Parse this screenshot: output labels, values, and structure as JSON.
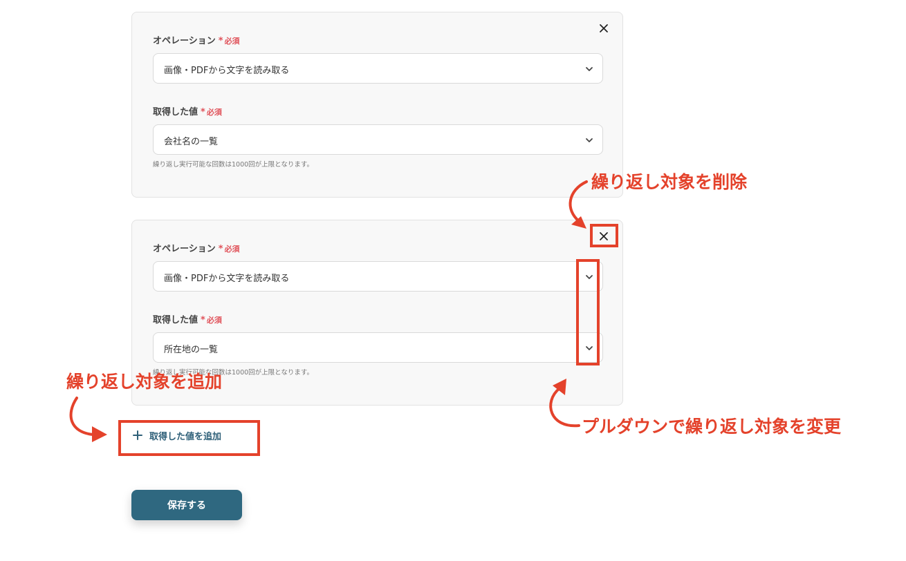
{
  "blocks": [
    {
      "operation_label": "オペレーション",
      "required_star": "*",
      "required_text": "必須",
      "operation_value": "画像・PDFから文字を読み取る",
      "value_label": "取得した値",
      "value_value": "会社名の一覧",
      "helper_text": "繰り返し実行可能な回数は1000回が上限となります。"
    },
    {
      "operation_label": "オペレーション",
      "required_star": "*",
      "required_text": "必須",
      "operation_value": "画像・PDFから文字を読み取る",
      "value_label": "取得した値",
      "value_value": "所在地の一覧",
      "helper_text": "繰り返し実行可能な回数は1000回が上限となります。"
    }
  ],
  "add_button_label": "取得した値を追加",
  "save_button_label": "保存する",
  "annotations": {
    "delete": "繰り返し対象を削除",
    "add": "繰り返し対象を追加",
    "change": "プルダウンで繰り返し対象を変更"
  },
  "colors": {
    "accent": "#2f6880",
    "annotation": "#e4422b",
    "required": "#e0525a"
  },
  "icons": {
    "close": "close-icon",
    "chevron": "chevron-down-icon",
    "plus": "plus-icon"
  }
}
